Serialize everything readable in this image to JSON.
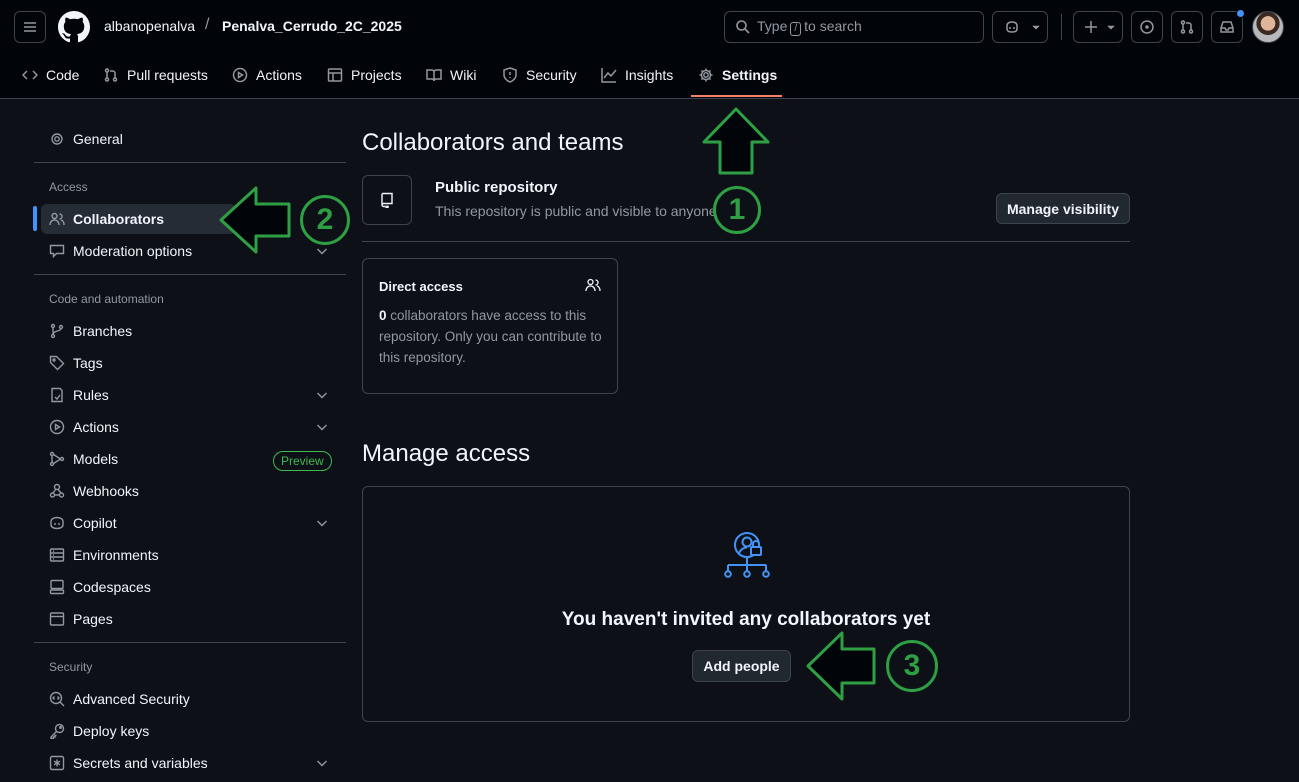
{
  "header": {
    "owner": "albanopenalva",
    "separator": "/",
    "repo": "Penalva_Cerrudo_2C_2025",
    "search_prefix": "Type",
    "search_key": "/",
    "search_suffix": "to search"
  },
  "repo_nav": {
    "items": [
      {
        "label": "Code",
        "icon": "code-icon"
      },
      {
        "label": "Pull requests",
        "icon": "pull-request-icon"
      },
      {
        "label": "Actions",
        "icon": "play-icon"
      },
      {
        "label": "Projects",
        "icon": "table-icon"
      },
      {
        "label": "Wiki",
        "icon": "book-icon"
      },
      {
        "label": "Security",
        "icon": "shield-icon"
      },
      {
        "label": "Insights",
        "icon": "graph-icon"
      },
      {
        "label": "Settings",
        "icon": "gear-icon",
        "active": true
      }
    ]
  },
  "sidebar": {
    "general": "General",
    "access_heading": "Access",
    "collaborators": "Collaborators",
    "moderation": "Moderation options",
    "code_heading": "Code and automation",
    "branches": "Branches",
    "tags": "Tags",
    "rules": "Rules",
    "actions": "Actions",
    "models": "Models",
    "models_badge": "Preview",
    "webhooks": "Webhooks",
    "copilot": "Copilot",
    "environments": "Environments",
    "codespaces": "Codespaces",
    "pages": "Pages",
    "security_heading": "Security",
    "advanced_security": "Advanced Security",
    "deploy_keys": "Deploy keys",
    "secrets": "Secrets and variables"
  },
  "main": {
    "title": "Collaborators and teams",
    "visibility_title": "Public repository",
    "visibility_desc": "This repository is public and visible to anyone",
    "manage_visibility": "Manage visibility",
    "direct_access_title": "Direct access",
    "direct_access_count": "0",
    "direct_access_text": " collaborators have access to this repository. Only you can contribute to this repository.",
    "manage_access_title": "Manage access",
    "empty_text": "You haven't invited any collaborators yet",
    "add_people": "Add people"
  },
  "annotations": {
    "step1": "1",
    "step2": "2",
    "step3": "3",
    "color": "#2ea043"
  },
  "colors": {
    "background": "#0d1117",
    "accent_underline": "#f78166",
    "selection": "#4493f8"
  }
}
